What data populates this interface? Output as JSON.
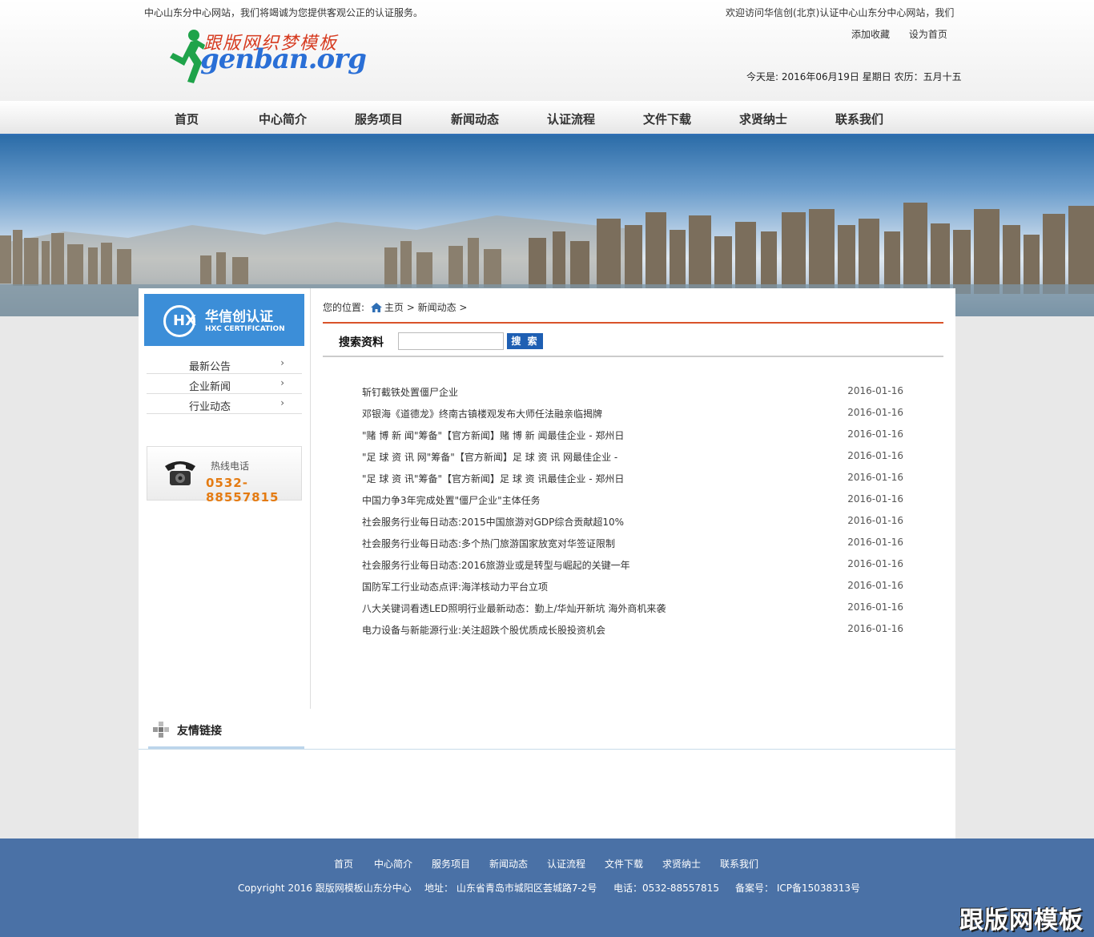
{
  "header": {
    "marquee": "中心山东分中心网站，我们将竭诚为您提供客观公正的认证服务。",
    "welcome": "欢迎访问华信创(北京)认证中心山东分中心网站，我们",
    "add_favorite": "添加收藏",
    "set_homepage": "设为首页",
    "today": "今天是: 2016年06月19日 星期日 农历：五月十五",
    "logo_cn": "跟版网织梦模板",
    "logo_en": "genban.org"
  },
  "nav": {
    "items": [
      "首页",
      "中心简介",
      "服务项目",
      "新闻动态",
      "认证流程",
      "文件下载",
      "求贤纳士",
      "联系我们"
    ]
  },
  "sidebar": {
    "brand_cn": "华信创认证",
    "brand_en": "HXC CERTIFICATION",
    "brand_mark": "HX",
    "menu": [
      {
        "label": "最新公告",
        "arrow": "›"
      },
      {
        "label": "企业新闻",
        "arrow": "›"
      },
      {
        "label": "行业动态",
        "arrow": "›"
      }
    ],
    "hotline_label": "热线电话",
    "hotline_number": "0532-88557815"
  },
  "breadcrumb": {
    "prefix": "您的位置:",
    "home": "主页",
    "sep1": " > ",
    "current": "新闻动态",
    "sep2": " >"
  },
  "search": {
    "label": "搜索资料",
    "button": "搜 索",
    "value": ""
  },
  "news": [
    {
      "title": "斩钉截铁处置僵尸企业",
      "date": "2016-01-16"
    },
    {
      "title": "邓银海《道德龙》终南古镇楼观发布大师任法融亲临揭牌",
      "date": "2016-01-16"
    },
    {
      "title": "\"赌 博 新 闻\"筹备\"【官方新闻】赌 博 新 闻最佳企业 - 郑州日",
      "date": "2016-01-16"
    },
    {
      "title": "\"足 球 资 讯 网\"筹备\"【官方新闻】足 球 资 讯 网最佳企业 -",
      "date": "2016-01-16"
    },
    {
      "title": "\"足 球 资 讯\"筹备\"【官方新闻】足 球 资 讯最佳企业 - 郑州日",
      "date": "2016-01-16"
    },
    {
      "title": "中国力争3年完成处置\"僵尸企业\"主体任务",
      "date": "2016-01-16"
    },
    {
      "title": "社会服务行业每日动态:2015中国旅游对GDP综合贡献超10%",
      "date": "2016-01-16"
    },
    {
      "title": "社会服务行业每日动态:多个热门旅游国家放宽对华签证限制",
      "date": "2016-01-16"
    },
    {
      "title": "社会服务行业每日动态:2016旅游业或是转型与崛起的关键一年",
      "date": "2016-01-16"
    },
    {
      "title": "国防军工行业动态点评:海洋核动力平台立项",
      "date": "2016-01-16"
    },
    {
      "title": "八大关键词看透LED照明行业最新动态：勤上/华灿开新坑 海外商机来袭",
      "date": "2016-01-16"
    },
    {
      "title": "电力设备与新能源行业:关注超跌个股优质成长股投资机会",
      "date": "2016-01-16"
    }
  ],
  "friend_links": {
    "title": "友情链接"
  },
  "footer": {
    "nav": [
      "首页",
      "中心简介",
      "服务项目",
      "新闻动态",
      "认证流程",
      "文件下载",
      "求贤纳士",
      "联系我们"
    ],
    "copyright": "Copyright 2016 跟版网模板山东分中心",
    "address": "地址：  山东省青岛市城阳区荟城路7-2号",
    "phone": "电话：0532-88557815",
    "icp": "备案号：  ICP备15038313号",
    "watermark": "跟版网模板"
  },
  "colors": {
    "nav_border": "#2f6fb5",
    "brand_blue": "#3c8ed8",
    "crumb_line": "#d9532a",
    "hotline_orange": "#e47b12",
    "footer_bg": "#4a71a6"
  }
}
